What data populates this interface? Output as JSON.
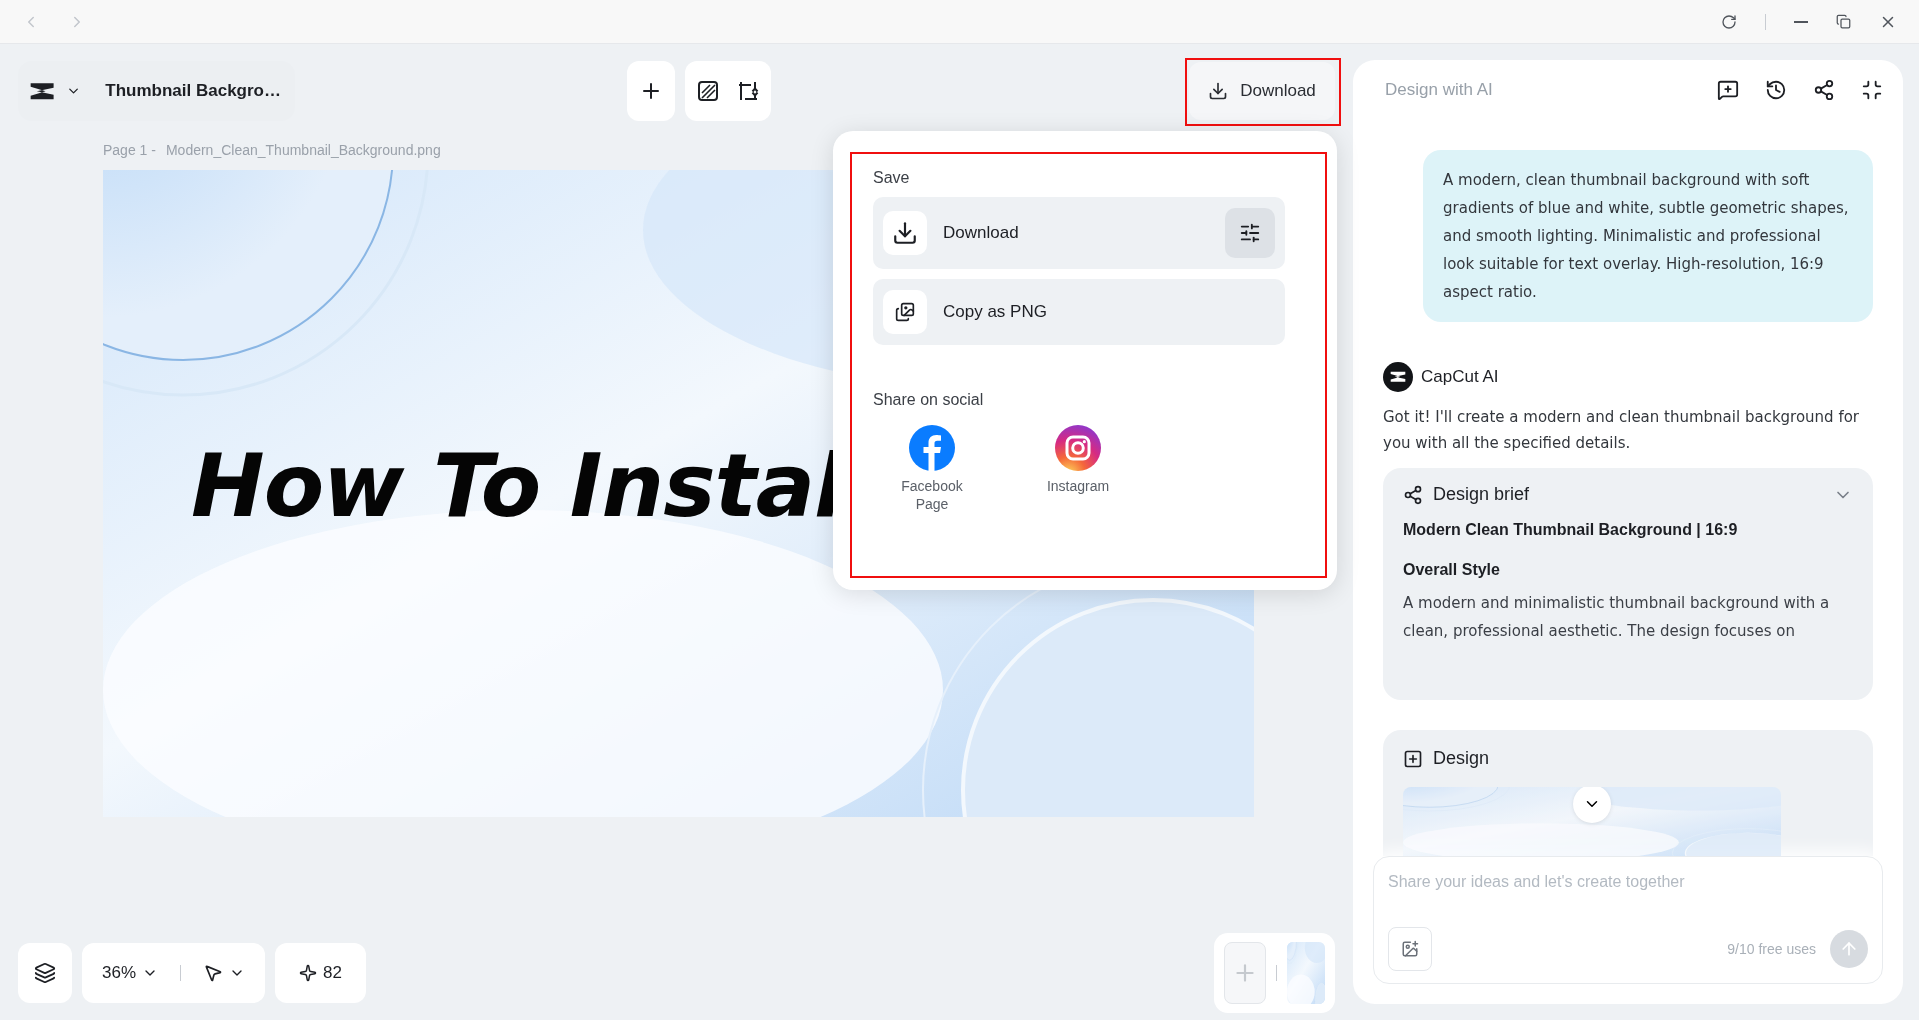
{
  "document": {
    "title": "Thumbnail Backgro…",
    "page_label": "Page 1 -",
    "file_name": "Modern_Clean_Thumbnail_Background.png"
  },
  "download_button": {
    "label": "Download"
  },
  "download_menu": {
    "save_heading": "Save",
    "save_items": [
      {
        "kind": "download",
        "label": "Download"
      },
      {
        "kind": "copy",
        "label": "Copy as PNG"
      }
    ],
    "share_heading": "Share on social",
    "share_items": [
      {
        "kind": "facebook",
        "label": "Facebook Page"
      },
      {
        "kind": "instagram",
        "label": "Instagram"
      }
    ]
  },
  "canvas": {
    "headline": "How To Instal"
  },
  "ai_panel": {
    "title": "Design with AI",
    "user_message": "A modern, clean thumbnail background with soft gradients of blue and white, subtle geometric shapes, and smooth lighting. Minimalistic and professional look suitable for text overlay. High-resolution, 16:9 aspect ratio.",
    "assistant_name": "CapCut AI",
    "assistant_message": "Got it! I'll create a modern and clean thumbnail background for you with all the specified details.",
    "brief": {
      "title": "Design brief",
      "heading": "Modern Clean Thumbnail Background | 16:9",
      "section": "Overall Style",
      "body": "A modern and minimalistic thumbnail background with a clean, professional aesthetic. The design focuses on"
    },
    "design": {
      "title": "Design"
    },
    "composer": {
      "placeholder": "Share your ideas and let's create together",
      "usage": "9/10 free uses"
    }
  },
  "bottom_bar": {
    "zoom": "36%",
    "credits": "82"
  }
}
